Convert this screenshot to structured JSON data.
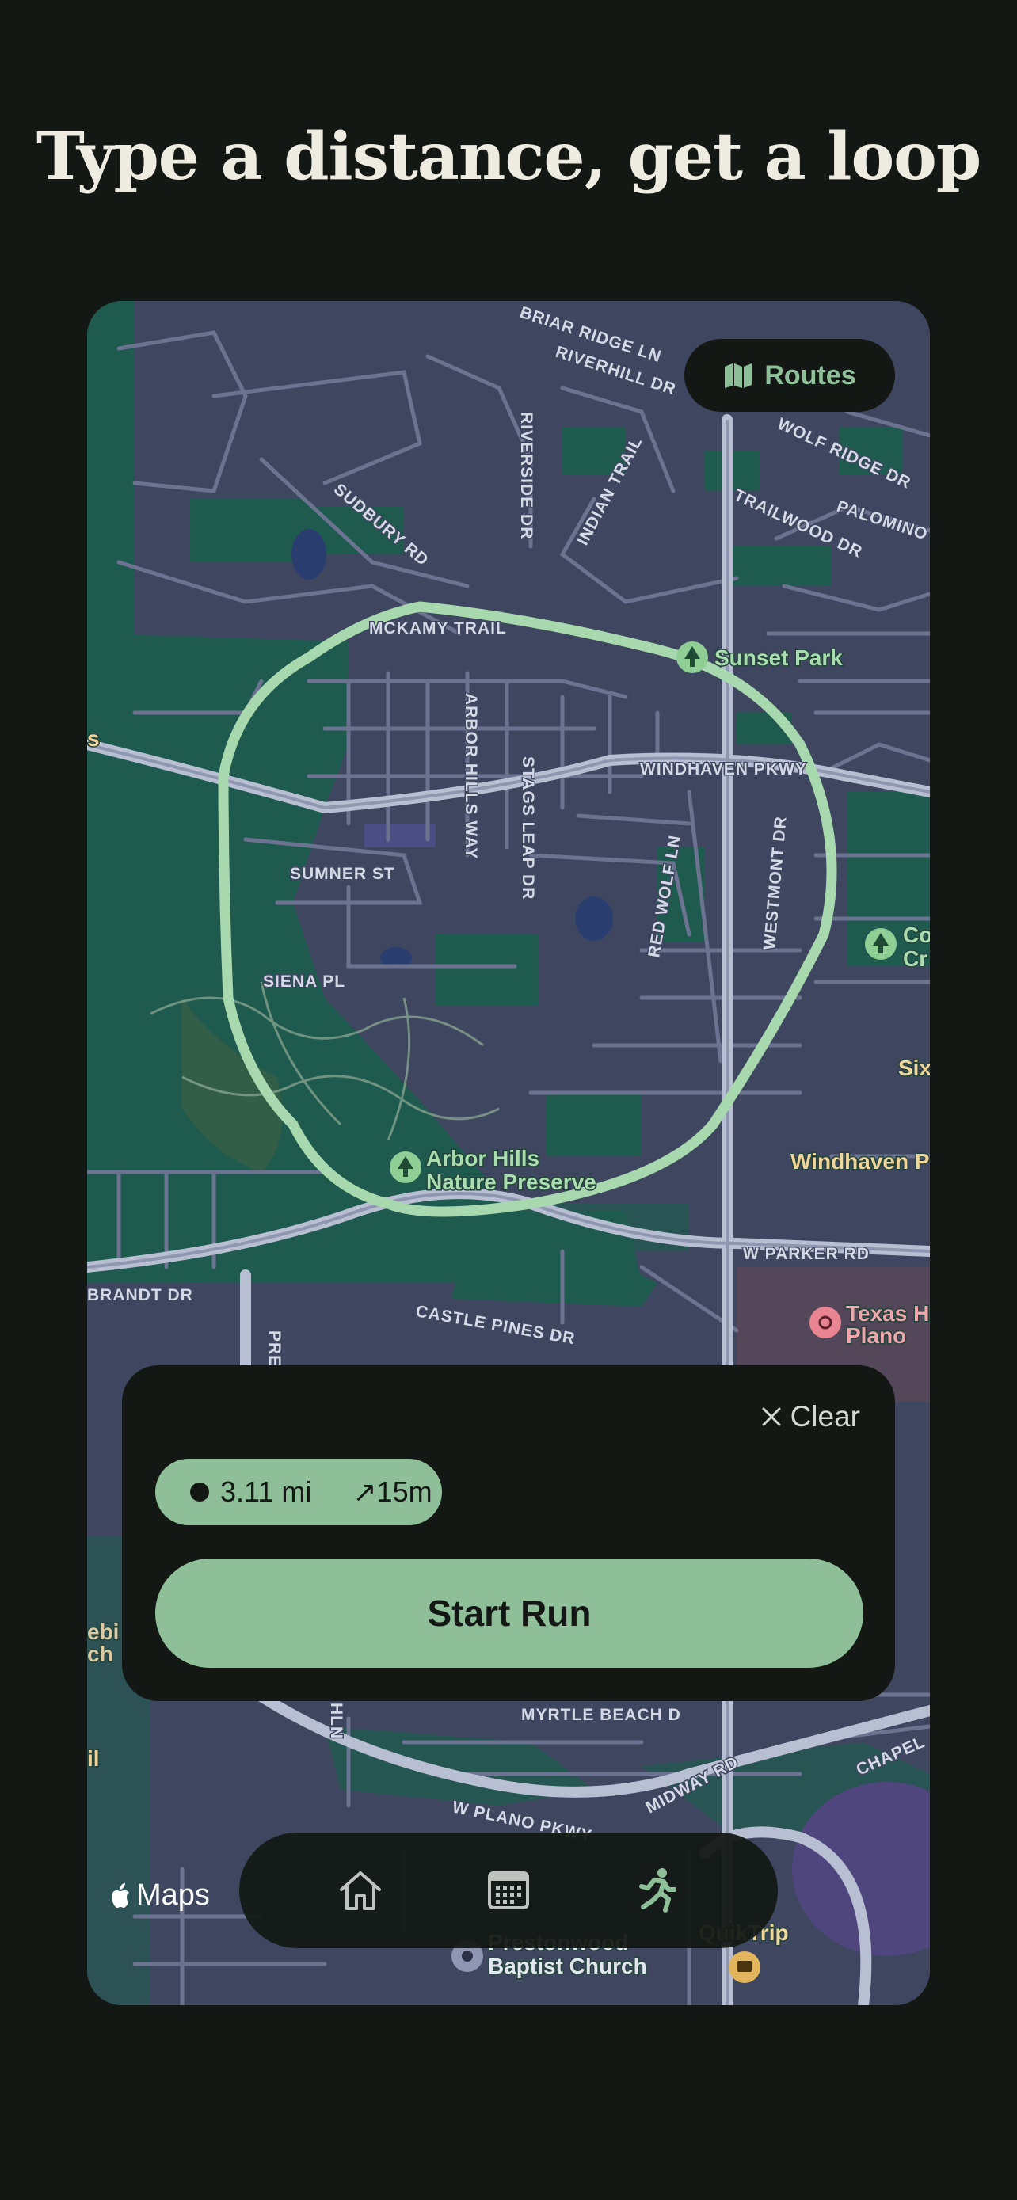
{
  "headline": "Type a distance, get a loop",
  "map": {
    "routes_button_label": "Routes",
    "route_color": "#a8d8ad",
    "streets": [
      "BRIAR RIDGE LN",
      "RIVERHILL DR",
      "SUDBURY RD",
      "RIVERSIDE DR",
      "INDIAN TRAIL",
      "WOLF RIDGE DR",
      "PALOMINO",
      "TRAILWOOD DR",
      "MCKAMY TRAIL",
      "ARBOR HILLS WAY",
      "STAGS LEAP DR",
      "WINDHAVEN PKWY",
      "SUMNER ST",
      "RED WOLF LN",
      "WESTMONT DR",
      "SIENA PL",
      "W PARKER RD",
      "BRANDT DR",
      "CASTLE PINES DR",
      "MYRTLE BEACH D",
      "W PLANO PKWY",
      "MIDWAY RD",
      "CHAPEL",
      "PRE",
      "HLN"
    ],
    "pois": {
      "sunset_park": "Sunset Park",
      "arbor_hills_line1": "Arbor Hills",
      "arbor_hills_line2": "Nature Preserve",
      "co_line1": "Co",
      "co_line2": "Cr",
      "six": "Six",
      "windhaven_p": "Windhaven P",
      "texas_line1": "Texas H",
      "texas_line2": "Plano",
      "prestonwood_line1": "Prestonwood",
      "prestonwood_line2": "Baptist Church",
      "quiktrip": "QuikTrip",
      "left_s": "s",
      "left_ebi": "ebi",
      "left_ch": "ch",
      "left_il": "il"
    },
    "attribution": "Maps"
  },
  "panel": {
    "clear_label": "Clear",
    "distance": "3.11 mi",
    "elevation": "↗15m",
    "start_label": "Start Run"
  },
  "tabbar": {
    "tabs": [
      {
        "icon": "home-icon"
      },
      {
        "icon": "calendar-icon"
      },
      {
        "icon": "runner-icon"
      }
    ]
  }
}
